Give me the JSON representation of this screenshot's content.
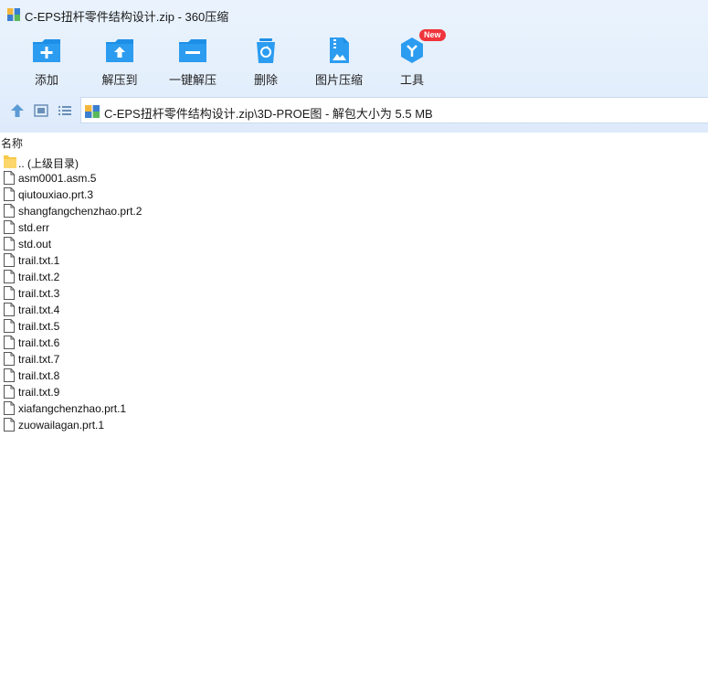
{
  "window": {
    "title": "C-EPS扭杆零件结构设计.zip - 360压缩"
  },
  "toolbar": {
    "items": [
      {
        "label": "添加",
        "icon": "add-icon"
      },
      {
        "label": "解压到",
        "icon": "extract-to-icon"
      },
      {
        "label": "一键解压",
        "icon": "one-click-extract-icon"
      },
      {
        "label": "删除",
        "icon": "delete-icon"
      },
      {
        "label": "图片压缩",
        "icon": "image-compress-icon"
      },
      {
        "label": "工具",
        "icon": "tools-icon",
        "badge": "New"
      }
    ]
  },
  "navbar": {
    "path": "C-EPS扭杆零件结构设计.zip\\3D-PROE图 - 解包大小为 5.5 MB"
  },
  "columns": {
    "name": "名称"
  },
  "files": [
    {
      "name": ".. (上级目录)",
      "type": "folder"
    },
    {
      "name": "asm0001.asm.5",
      "type": "file"
    },
    {
      "name": "qiutouxiao.prt.3",
      "type": "file"
    },
    {
      "name": "shangfangchenzhao.prt.2",
      "type": "file"
    },
    {
      "name": "std.err",
      "type": "file"
    },
    {
      "name": "std.out",
      "type": "file"
    },
    {
      "name": "trail.txt.1",
      "type": "file"
    },
    {
      "name": "trail.txt.2",
      "type": "file"
    },
    {
      "name": "trail.txt.3",
      "type": "file"
    },
    {
      "name": "trail.txt.4",
      "type": "file"
    },
    {
      "name": "trail.txt.5",
      "type": "file"
    },
    {
      "name": "trail.txt.6",
      "type": "file"
    },
    {
      "name": "trail.txt.7",
      "type": "file"
    },
    {
      "name": "trail.txt.8",
      "type": "file"
    },
    {
      "name": "trail.txt.9",
      "type": "file"
    },
    {
      "name": "xiafangchenzhao.prt.1",
      "type": "file"
    },
    {
      "name": "zuowailagan.prt.1",
      "type": "file"
    }
  ],
  "colors": {
    "accent": "#1e8fe6",
    "badge": "#f0343c",
    "folder": "#f7c948"
  }
}
